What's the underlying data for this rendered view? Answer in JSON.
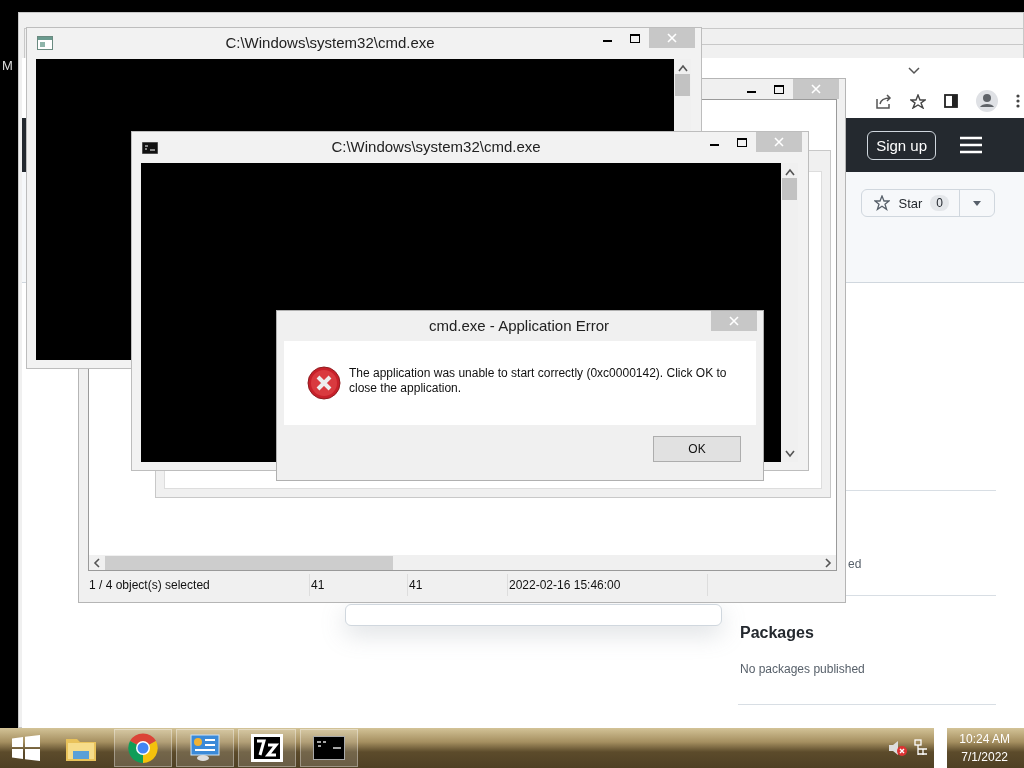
{
  "desktop": {
    "label": "M"
  },
  "browser": {
    "sign_up_button": "Sign up",
    "star_button": {
      "label": "Star",
      "count": "0"
    },
    "sidebar": {
      "partial_text": "ed",
      "sections": [
        {
          "heading": "Packages",
          "text": "No packages published"
        }
      ]
    }
  },
  "file_manager": {
    "status_bar": [
      "1 / 4 object(s) selected",
      "41",
      "41",
      "2022-02-16 15:46:00"
    ]
  },
  "console_windows": [
    {
      "title": "C:\\Windows\\system32\\cmd.exe"
    },
    {
      "title": "C:\\Windows\\system32\\cmd.exe"
    }
  ],
  "error_dialog": {
    "title": "cmd.exe - Application Error",
    "message": "The application was unable to start correctly (0xc0000142). Click OK to close the application.",
    "buttons": [
      "OK"
    ]
  },
  "taskbar": {
    "apps": [
      {
        "kind": "file-explorer",
        "running": false
      },
      {
        "kind": "web-browser",
        "running": true
      },
      {
        "kind": "control-panel",
        "running": true
      },
      {
        "kind": "archiver",
        "running": true
      },
      {
        "kind": "console",
        "running": true
      }
    ],
    "clock": {
      "time": "10:24 AM",
      "date": "7/1/2022"
    }
  }
}
